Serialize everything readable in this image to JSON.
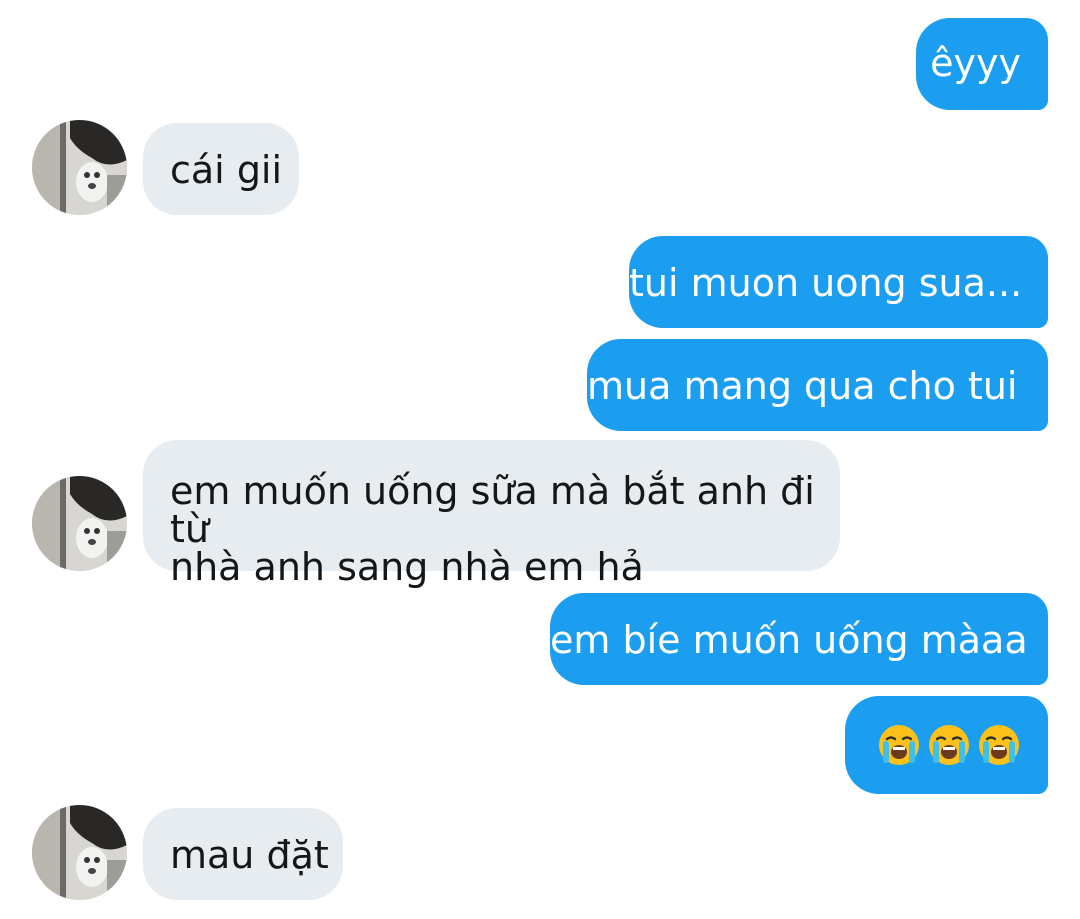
{
  "conversation": {
    "messages": [
      {
        "sender": "me",
        "text": "êyyy"
      },
      {
        "sender": "them",
        "text": "cái gii"
      },
      {
        "sender": "me",
        "text": "tui muon uong sua..."
      },
      {
        "sender": "me",
        "text": "mua mang qua cho tui"
      },
      {
        "sender": "them",
        "text": "em muốn uống sữa mà bắt anh đi từ\nnhà anh sang nhà em hả"
      },
      {
        "sender": "me",
        "text": "em bíe muốn uống màaa"
      },
      {
        "sender": "me",
        "emoji": [
          "loudly-crying-face",
          "loudly-crying-face",
          "loudly-crying-face"
        ]
      },
      {
        "sender": "them",
        "text": "mau đặt"
      }
    ]
  },
  "colors": {
    "outgoing_bubble": "#1c9ef0",
    "incoming_bubble": "#e7ecf0",
    "outgoing_text": "#ffffff",
    "incoming_text": "#14171a"
  },
  "icons": {
    "avatar": "contact-avatar-photo",
    "emoji": "loudly-crying-face"
  }
}
